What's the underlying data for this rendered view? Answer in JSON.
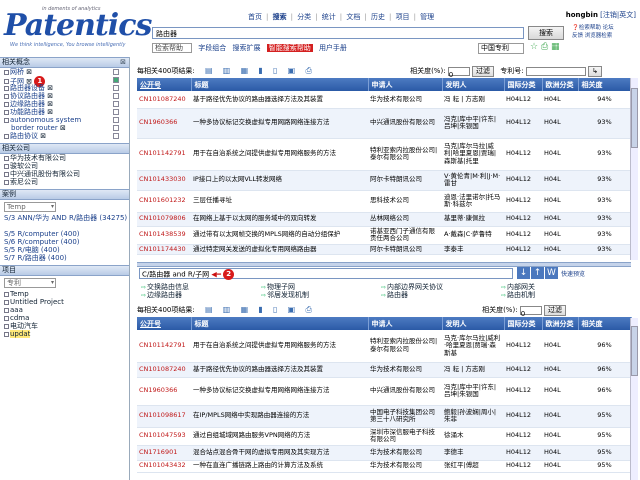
{
  "header": {
    "logo_text": "Patentics",
    "logo_sup": "in dements of analytics",
    "logo_tagline": "We think intelligence, You browse intelligently",
    "nav": [
      "首页",
      "搜索",
      "分类",
      "统计",
      "文档",
      "历史",
      "项目",
      "管理"
    ],
    "user": "hongbin",
    "user_links": "[注销|英文]",
    "search_value": "路由器",
    "search_button": "搜索",
    "right_icons": [
      "检索帮助",
      "论坛",
      "反馈",
      "浏览器检索"
    ],
    "help_select": "检索帮助",
    "sub_links": [
      "字段组合",
      "搜索扩展",
      "智能搜索帮助",
      "用户手册"
    ],
    "country_select": "中国专利"
  },
  "sidebar": {
    "sections": [
      {
        "title": "相关概念",
        "items": [
          {
            "label": "网桥",
            "checked": false
          },
          {
            "label": "子网",
            "checked": true,
            "badge": "1"
          },
          {
            "label": "路由器设备",
            "checked": false
          },
          {
            "label": "协议路由器",
            "checked": false
          },
          {
            "label": "边缘路由器",
            "checked": false
          },
          {
            "label": "功能路由器",
            "checked": false
          },
          {
            "label": "autonomous system",
            "checked": false
          },
          {
            "label": "border router",
            "checked": false
          },
          {
            "label": "路由协议",
            "checked": false
          }
        ]
      },
      {
        "title": "相关公司",
        "items": [
          {
            "label": "华为技术有限公司"
          },
          {
            "label": "骏软公司"
          },
          {
            "label": "中兴通讯股份有限公司"
          },
          {
            "label": "索尼公司"
          }
        ]
      },
      {
        "title": "案例",
        "select": "Temp",
        "items": [
          {
            "label": "S/3 ANN/华为 AND R/路由器 (34275)"
          },
          {
            "label": "S/5 R/computer (400)"
          },
          {
            "label": "S/6 R/computer (400)"
          },
          {
            "label": "S/5 R/电脑 (400)"
          },
          {
            "label": "S/7 R/路由器 (400)"
          }
        ]
      },
      {
        "title": "项目",
        "select": "专利",
        "items": [
          {
            "label": "Temp"
          },
          {
            "label": "Untitled Project"
          },
          {
            "label": "aaa"
          },
          {
            "label": "cdma"
          },
          {
            "label": "电动汽车"
          },
          {
            "label": "updat"
          }
        ]
      }
    ]
  },
  "results_top": {
    "count_label": "每相关400项结果:",
    "relevance_label": "相关度(%):",
    "relevance_value": "0",
    "filter_button": "过滤",
    "patent_no_label": "专利号:",
    "columns": [
      "公开号",
      "标题",
      "申请人",
      "发明人",
      "国际分类",
      "欧洲分类",
      "相关度"
    ],
    "rows": [
      [
        "CN101087240",
        "基于路径优先协议的路由器选择方法及其装置",
        "华为技术有限公司",
        "冯 耘 | 方志刚",
        "H04L12",
        "H04L",
        "94%"
      ],
      [
        "CN1960366",
        "一种多协议标记交换虚拟专用网路网络连接方法",
        "中兴通讯股份有限公司",
        "冯克|库中平|许东|吕坤|朱银国",
        "H04L12",
        "H04L",
        "93%"
      ],
      [
        "CN101142791",
        "用于在自治系统之间提供虚拟专用网络服务的方法",
        "特利亚索内拉股份公司|泰尔有限公司",
        "马克|库尔马拉|威利|哈里夏恩|贾瑞|森斯基|托里",
        "H04L12",
        "H04L",
        "93%"
      ],
      [
        "CN101433030",
        "IP接口上的以太网VLL转发网络",
        "阿尔卡特朗讯公司",
        "V·黄伦青|M·利|J·M·雷甘",
        "H04L12",
        "H04L",
        "93%"
      ],
      [
        "CN101601232",
        "三层任播寻址",
        "思科技术公司",
        "迪恩·法里诺尔|托马斯·科兹尔",
        "H04L12",
        "H04L",
        "93%"
      ],
      [
        "CN101079806",
        "在网络上基于以太网的服务域中的双向转发",
        "丛林网络公司",
        "基里蒂·康佩拉",
        "H04L12",
        "H04L",
        "93%"
      ],
      [
        "CN101438539",
        "通过带有以太网帧交换的MPLS网络的自动分组保护",
        "诺基亚西门子通信有限责任两合公司",
        "A·戴森|C·萨鲁特",
        "H04L12",
        "H04L",
        "93%"
      ],
      [
        "CN101174430",
        "通过特定网关发送的虚拟化专用网络路由器",
        "阿尔卡特朗讯公司",
        "李泰丰",
        "H04L12",
        "H04L",
        "93%"
      ]
    ]
  },
  "query_bar": {
    "value": "C/路由器 and R/子网",
    "badge": "2",
    "buttons": [
      "↓",
      "↑",
      "W"
    ],
    "extra": "快速预览"
  },
  "tree": [
    "交换路由信息",
    "物理子网",
    "内部边界网关协议",
    "内部网关",
    "边缘路由器",
    "邻居发现机制",
    "路由器",
    "路由机制"
  ],
  "results_bottom": {
    "count_label": "每相关400项结果:",
    "relevance_label": "相关度(%):",
    "relevance_value": "0",
    "filter_button": "过滤",
    "columns": [
      "公开号",
      "标题",
      "申请人",
      "发明人",
      "国际分类",
      "欧洲分类",
      "相关度"
    ],
    "rows": [
      [
        "CN101142791",
        "用于在自治系统之间提供虚拟专用网络服务的方法",
        "特利亚索内拉股份公司|泰尔有限公司",
        "马克·库尔马拉|威利·哈里夏恩|贾瑞·森斯基",
        "H04L12",
        "H04L",
        "96%"
      ],
      [
        "CN101087240",
        "基于路径优先协议的路由器选择方法及其装置",
        "华为技术有限公司",
        "冯 耘 | 方志刚",
        "H04L12",
        "H04L",
        "96%"
      ],
      [
        "CN1960366",
        "一种多协议标记交换虚拟专用网络网络连接方法",
        "中兴通讯股份有限公司",
        "冯克|库中平|许东|吕坤|朱银国",
        "H04L12",
        "H04L",
        "96%"
      ],
      [
        "CN101098617",
        "在IP/MPLS网络中实现路由器连接的方法",
        "中国电子科技集团公司第三十八研究所",
        "鲍毅|孙波娴|周小|朱菲",
        "H04L12",
        "H04L",
        "95%"
      ],
      [
        "CN101047593",
        "通过自组城域网路由服务VPN网络的方法",
        "深圳市深信服电子科技有限公司",
        "徐涌木",
        "H04L12",
        "H04L",
        "95%"
      ],
      [
        "CN1716901",
        "混合站点混合骨干网的虚拟专用网及其实现方法",
        "华为技术有限公司",
        "李德丰",
        "H04L12",
        "H04L",
        "95%"
      ],
      [
        "CN101043432",
        "一种在直连广播链路上路由的计算方法及系统",
        "华为技术有限公司",
        "张红平|傅超",
        "H04L12",
        "H04L",
        "95%"
      ]
    ]
  }
}
